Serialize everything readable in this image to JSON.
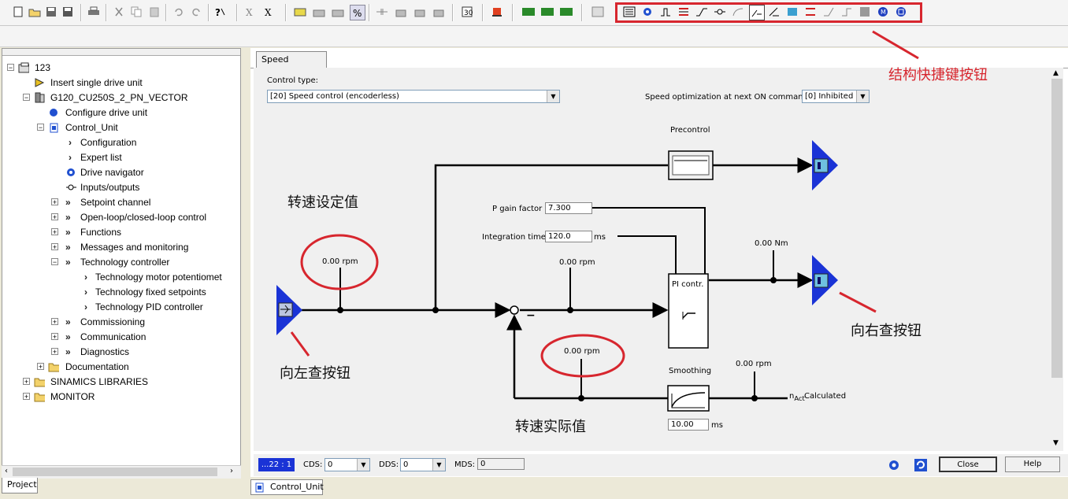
{
  "toolbar": {
    "icons": [
      "new-icon",
      "open-icon",
      "save-icon",
      "save-compile-icon",
      "print-icon",
      "cut-icon",
      "copy-icon",
      "paste-icon",
      "undo-icon",
      "redo-icon",
      "help-icon"
    ]
  },
  "annotations": {
    "struct_buttons": "结构快捷键按钮",
    "setpoint": "转速设定值",
    "left_button": "向左查按钮",
    "actual": "转速实际值",
    "right_button": "向右查按钮"
  },
  "tree": {
    "items": [
      {
        "label": "123"
      },
      {
        "label": "Insert single drive unit"
      },
      {
        "label": "G120_CU250S_2_PN_VECTOR"
      },
      {
        "label": "Configure drive unit"
      },
      {
        "label": "Control_Unit"
      },
      {
        "label": "Configuration"
      },
      {
        "label": "Expert list"
      },
      {
        "label": "Drive navigator"
      },
      {
        "label": "Inputs/outputs"
      },
      {
        "label": "Setpoint channel"
      },
      {
        "label": "Open-loop/closed-loop control"
      },
      {
        "label": "Functions"
      },
      {
        "label": "Messages and monitoring"
      },
      {
        "label": "Technology controller"
      },
      {
        "label": "Technology motor potentiomet"
      },
      {
        "label": "Technology fixed setpoints"
      },
      {
        "label": "Technology PID controller"
      },
      {
        "label": "Commissioning"
      },
      {
        "label": "Communication"
      },
      {
        "label": "Diagnostics"
      },
      {
        "label": "Documentation"
      },
      {
        "label": "SINAMICS LIBRARIES"
      },
      {
        "label": "MONITOR"
      }
    ],
    "tab": "Project"
  },
  "main": {
    "tab": "Speed controller",
    "control_type_label": "Control type:",
    "control_type_value": "[20] Speed control (encoderless)",
    "speed_opt_label": "Speed optimization at next ON command",
    "speed_opt_value": "[0] Inhibited",
    "precontrol": "Precontrol",
    "p_gain_label": "P gain factor",
    "p_gain_value": "7.300",
    "int_time_label": "Integration time",
    "int_time_value": "120.0",
    "int_time_unit": "ms",
    "setpoint_rpm": "0.00 rpm",
    "after_sum_rpm": "0.00 rpm",
    "actual_rpm": "0.00 rpm",
    "smoothed_rpm": "0.00 rpm",
    "torque": "0.00 Nm",
    "pi_ctrl": "PI contr.",
    "smoothing": "Smoothing",
    "smoothing_value": "10.00",
    "smoothing_unit": "ms",
    "n_act_main": "n",
    "n_act_sub": "Act",
    "n_act_calc": "Calculated",
    "minus": "−"
  },
  "status": {
    "drive_num": "...22 : 1",
    "cds_label": "CDS:",
    "cds_value": "0",
    "dds_label": "DDS:",
    "dds_value": "0",
    "mds_label": "MDS:",
    "mds_value": "0",
    "close": "Close",
    "help": "Help"
  },
  "bottom_tab": "Control_Unit",
  "colors": {
    "annotation_red": "#d7262e",
    "nav_blue": "#1a33d6",
    "struct_box": "#d7262e"
  }
}
